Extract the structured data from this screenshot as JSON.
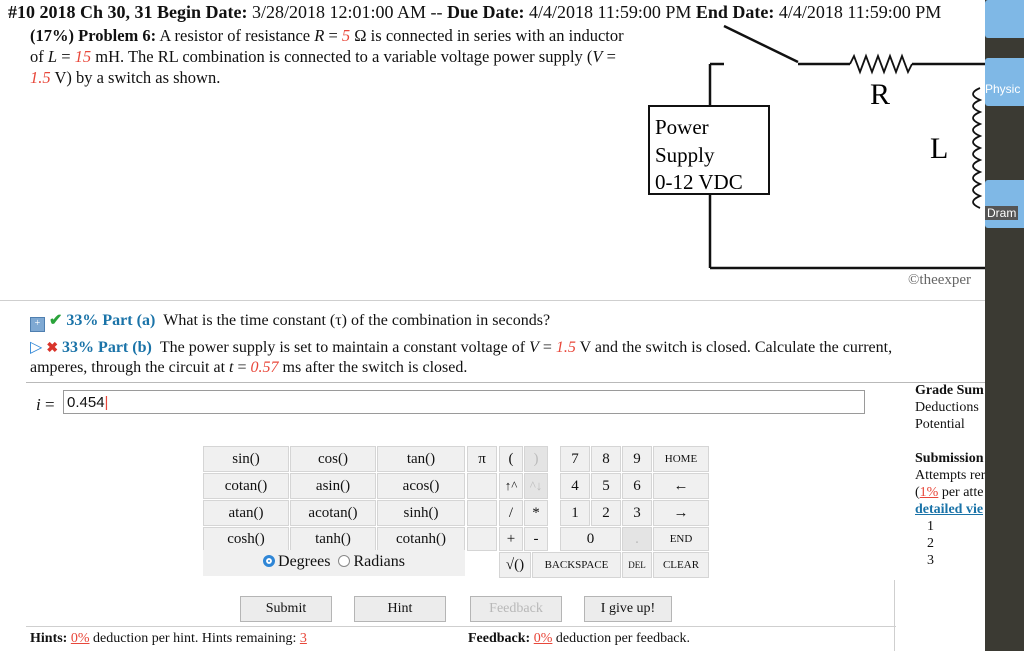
{
  "header": {
    "title": "#10 2018 Ch 30, 31",
    "begin_label": "Begin Date:",
    "begin_value": "3/28/2018 12:01:00 AM --",
    "due_label": "Due Date:",
    "due_value": "4/4/2018 11:59:00 PM",
    "end_label": "End Date:",
    "end_value": "4/4/2018 11:59:00 PM"
  },
  "problem": {
    "heading": "(17%) Problem 6:",
    "t1": " A resistor of resistance ",
    "R_sym": "R",
    "eq1": " = ",
    "R_val": "5",
    "t2": " Ω is connected in series with an inductor of ",
    "L_sym": "L",
    "eq2": " = ",
    "L_val": "15",
    "t3": " mH. The RL combination is connected to a variable voltage power supply (",
    "V_sym": "V",
    "eq3": " = ",
    "V_val": "1.5",
    "t4": " V) by a switch as shown."
  },
  "diagram": {
    "power_l1": "Power",
    "power_l2": "Supply",
    "power_l3": "0-12 VDC",
    "R_label": "R",
    "L_label": "L",
    "credit": "©theexper"
  },
  "part_a": {
    "pct": "33%",
    "label": "Part (a)",
    "question": "What is the time constant (τ) of the combination in seconds?"
  },
  "part_b": {
    "pct": "33%",
    "label": "Part (b)",
    "q1": "The power supply is set to maintain a constant voltage of ",
    "V_sym": "V",
    "eq": " = ",
    "V_val": "1.5",
    "q2": " V and the switch is closed. Calculate the current,",
    "q3": "amperes, through the circuit at ",
    "t_sym": "t",
    "eq2": " = ",
    "t_val": "0.57",
    "q4": " ms after the switch is closed."
  },
  "answer": {
    "label_sym": "i",
    "label_eq": " =",
    "value": "0.454"
  },
  "grade": {
    "title": "Grade Sum",
    "deductions": "Deductions",
    "potential": "Potential"
  },
  "submissions": {
    "title": "Submission",
    "attempts": "Attempts rer",
    "per_open": "(",
    "pct": "1%",
    "per_text": " per atte",
    "link": "detailed vie",
    "n1": "1",
    "n2": "2",
    "n3": "3"
  },
  "calc": {
    "funcs": [
      "sin()",
      "cos()",
      "tan()",
      "cotan()",
      "asin()",
      "acos()",
      "atan()",
      "acotan()",
      "sinh()",
      "cosh()",
      "tanh()",
      "cotanh()"
    ],
    "degrees": "Degrees",
    "radians": "Radians",
    "pi": "π",
    "lparen": "(",
    "rparen": ")",
    "k7": "7",
    "k8": "8",
    "k9": "9",
    "home": "HOME",
    "up": "↑^",
    "down": "^↓",
    "k4": "4",
    "k5": "5",
    "k6": "6",
    "left": "←",
    "div": "/",
    "mul": "*",
    "k1": "1",
    "k2": "2",
    "k3": "3",
    "right": "→",
    "plus": "+",
    "minus": "-",
    "k0": "0",
    "dot": ".",
    "end": "END",
    "sqrt": "√()",
    "backspace": "BACKSPACE",
    "del": "DEL",
    "clear": "CLEAR"
  },
  "buttons": {
    "submit": "Submit",
    "hint": "Hint",
    "feedback": "Feedback",
    "give_up": "I give up!"
  },
  "footer": {
    "hints_label": "Hints:",
    "hints_pct": "0%",
    "hints_text": " deduction per hint. Hints remaining: ",
    "hints_remaining": "3",
    "feedback_label": "Feedback:",
    "feedback_pct": "0%",
    "feedback_text": " deduction per feedback."
  },
  "side": {
    "label1": "Physic",
    "label2": "Dram"
  }
}
